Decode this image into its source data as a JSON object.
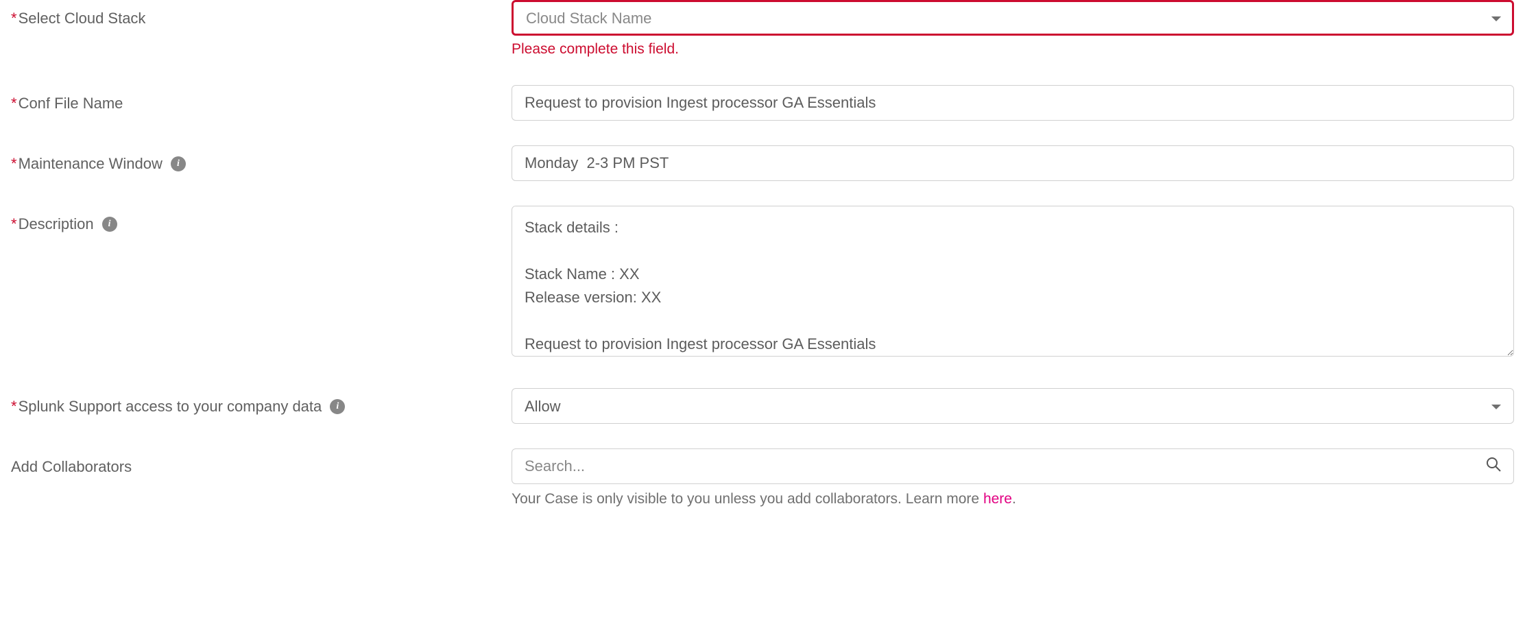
{
  "form": {
    "cloudStack": {
      "label": "Select Cloud Stack",
      "required": true,
      "placeholder": "Cloud Stack Name",
      "error": "Please complete this field."
    },
    "confFileName": {
      "label": "Conf File Name",
      "required": true,
      "value": "Request to provision Ingest processor GA Essentials"
    },
    "maintenanceWindow": {
      "label": "Maintenance Window",
      "required": true,
      "hasInfo": true,
      "value": "Monday  2-3 PM PST"
    },
    "description": {
      "label": "Description",
      "required": true,
      "hasInfo": true,
      "value": "Stack details :\n\nStack Name : XX\nRelease version: XX\n\nRequest to provision Ingest processor GA Essentials"
    },
    "supportAccess": {
      "label": "Splunk Support access to your company data",
      "required": true,
      "hasInfo": true,
      "value": "Allow"
    },
    "collaborators": {
      "label": "Add Collaborators",
      "required": false,
      "placeholder": "Search...",
      "helperPrefix": "Your Case is only visible to you unless you add collaborators. Learn more ",
      "helperLinkText": "here",
      "helperSuffix": "."
    }
  }
}
